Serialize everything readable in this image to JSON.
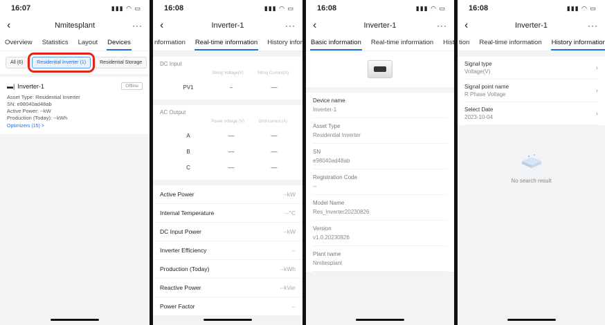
{
  "screen1": {
    "time": "16:07",
    "title": "Nmitesplant",
    "tabs": [
      "Overview",
      "Statistics",
      "Layout",
      "Devices"
    ],
    "filters": [
      "All (6)",
      "Residential Inverter (1)",
      "Residential Storage"
    ],
    "device": {
      "name": "Inverter-1",
      "status": "Offline",
      "asset_type": "Asset Type:  Residential Inverter",
      "sn": "SN:  e98040ad48ab",
      "active_power": "Active Power:  --kW",
      "production": "Production (Today):  --kWh",
      "optimizers": "Optimizers (15) >"
    }
  },
  "screen2": {
    "time": "16:08",
    "title": "Inverter-1",
    "tabs": [
      "nformation",
      "Real-time information",
      "History inform"
    ],
    "dc_title": "DC Input",
    "dc_cols": [
      "String Voltage(V)",
      "String Current(A)"
    ],
    "dc_rows": [
      {
        "name": "PV1",
        "a": "–",
        "b": "––"
      }
    ],
    "ac_title": "AC Output",
    "ac_cols": [
      "Power voltage (V)",
      "Grid current (A)"
    ],
    "ac_rows": [
      {
        "name": "A",
        "a": "––",
        "b": "––"
      },
      {
        "name": "B",
        "a": "––",
        "b": "––"
      },
      {
        "name": "C",
        "a": "––",
        "b": "––"
      }
    ],
    "metrics": [
      {
        "label": "Active Power",
        "value": "--kW"
      },
      {
        "label": "Internal Temperature",
        "value": "--°C"
      },
      {
        "label": "DC Input Power",
        "value": "--kW"
      },
      {
        "label": "Inverter Efficiency",
        "value": "--"
      },
      {
        "label": "Production (Today)",
        "value": "--kWh"
      },
      {
        "label": "Reactive Power",
        "value": "--kVar"
      },
      {
        "label": "Power Factor",
        "value": "--"
      }
    ]
  },
  "screen3": {
    "time": "16:08",
    "title": "Inverter-1",
    "tabs": [
      "Basic information",
      "Real-time information",
      "Histo"
    ],
    "fields": [
      {
        "label": "Device name",
        "value": "Inverter-1"
      },
      {
        "label": "Asset Type",
        "value": "Residential Inverter"
      },
      {
        "label": "SN",
        "value": "e98040ad48ab"
      },
      {
        "label": "Registration Code",
        "value": "--"
      },
      {
        "label": "Model Name",
        "value": "Res_Inverter20230826"
      },
      {
        "label": "Version",
        "value": "v1.0.20230826"
      },
      {
        "label": "Plant name",
        "value": "Nmitesplant"
      }
    ]
  },
  "screen4": {
    "time": "16:08",
    "title": "Inverter-1",
    "tabs": [
      "tion",
      "Real-time information",
      "History information"
    ],
    "items": [
      {
        "label": "Signal type",
        "value": "Voltage(V)"
      },
      {
        "label": "Signal point name",
        "value": "R Phase Voltage"
      },
      {
        "label": "Select Date",
        "value": "2023-10-04"
      }
    ],
    "empty_text": "No search result"
  },
  "colors": {
    "accent": "#1e6fd9",
    "highlight": "#e2231a"
  }
}
